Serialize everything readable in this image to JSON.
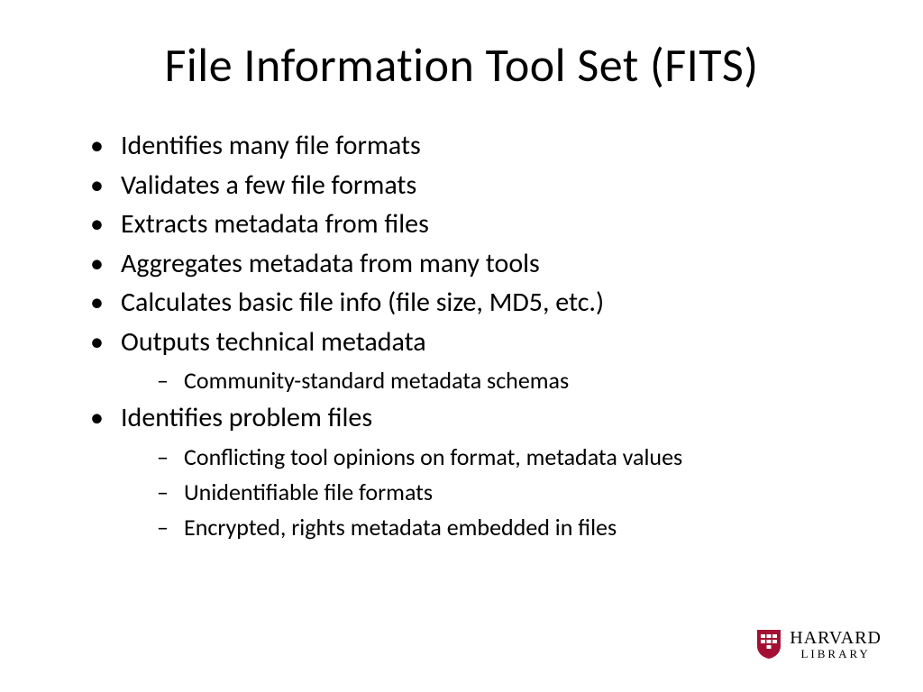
{
  "slide": {
    "title": "File Information Tool Set (FITS)",
    "bullets": {
      "b0": "Identifies many file formats",
      "b1": "Validates a few file formats",
      "b2": "Extracts metadata from files",
      "b3": "Aggregates metadata from many tools",
      "b4": "Calculates basic file info (file size, MD5, etc.)",
      "b5": "Outputs technical metadata",
      "b5_sub": {
        "s0": "Community-standard metadata schemas"
      },
      "b6": "Identifies problem files",
      "b6_sub": {
        "s0": "Conflicting tool opinions on format, metadata values",
        "s1": "Unidentifiable file formats",
        "s2": "Encrypted, rights metadata embedded in files"
      }
    }
  },
  "logo": {
    "org": "HARVARD",
    "unit": "LIBRARY",
    "shield_color": "#a41034"
  }
}
